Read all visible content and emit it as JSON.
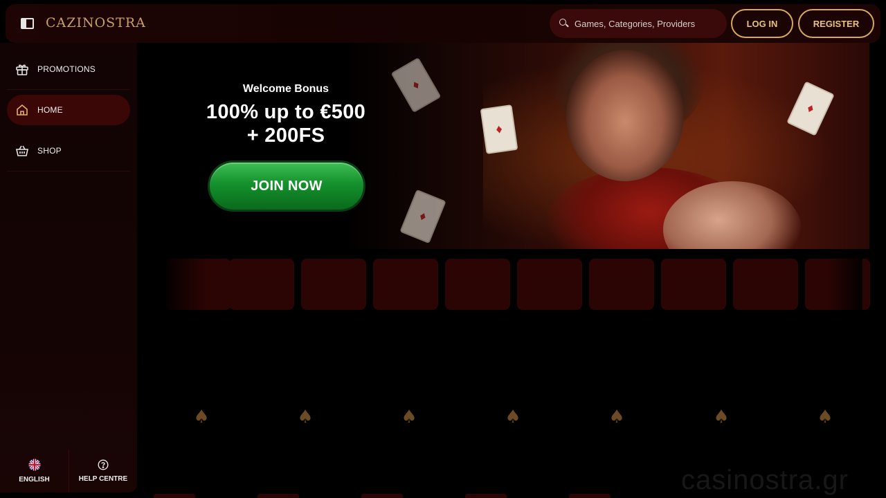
{
  "header": {
    "logo": "CAZINOSTRA",
    "search_placeholder": "Games, Categories, Providers",
    "login_label": "LOG IN",
    "register_label": "REGISTER"
  },
  "sidebar": {
    "items": [
      {
        "label": "PROMOTIONS",
        "icon": "gift-icon"
      },
      {
        "label": "HOME",
        "icon": "home-icon",
        "active": true
      },
      {
        "label": "SHOP",
        "icon": "basket-icon"
      }
    ],
    "footer": [
      {
        "label": "ENGLISH",
        "icon": "uk-flag-icon"
      },
      {
        "label": "HELP CENTRE",
        "icon": "help-circle-icon"
      }
    ]
  },
  "banner": {
    "title": "Welcome Bonus",
    "bonus_line_1": "100% up to €500",
    "bonus_line_2": "+ 200FS",
    "cta_label": "JOIN NOW"
  },
  "watermark": "casinostra.gr",
  "colors": {
    "accent_gold": "#d8a957",
    "header_bg": "#1e0404",
    "active_nav_bg": "#3a0606",
    "tile_bg": "#2b0404",
    "cta_green": "#14912c"
  }
}
